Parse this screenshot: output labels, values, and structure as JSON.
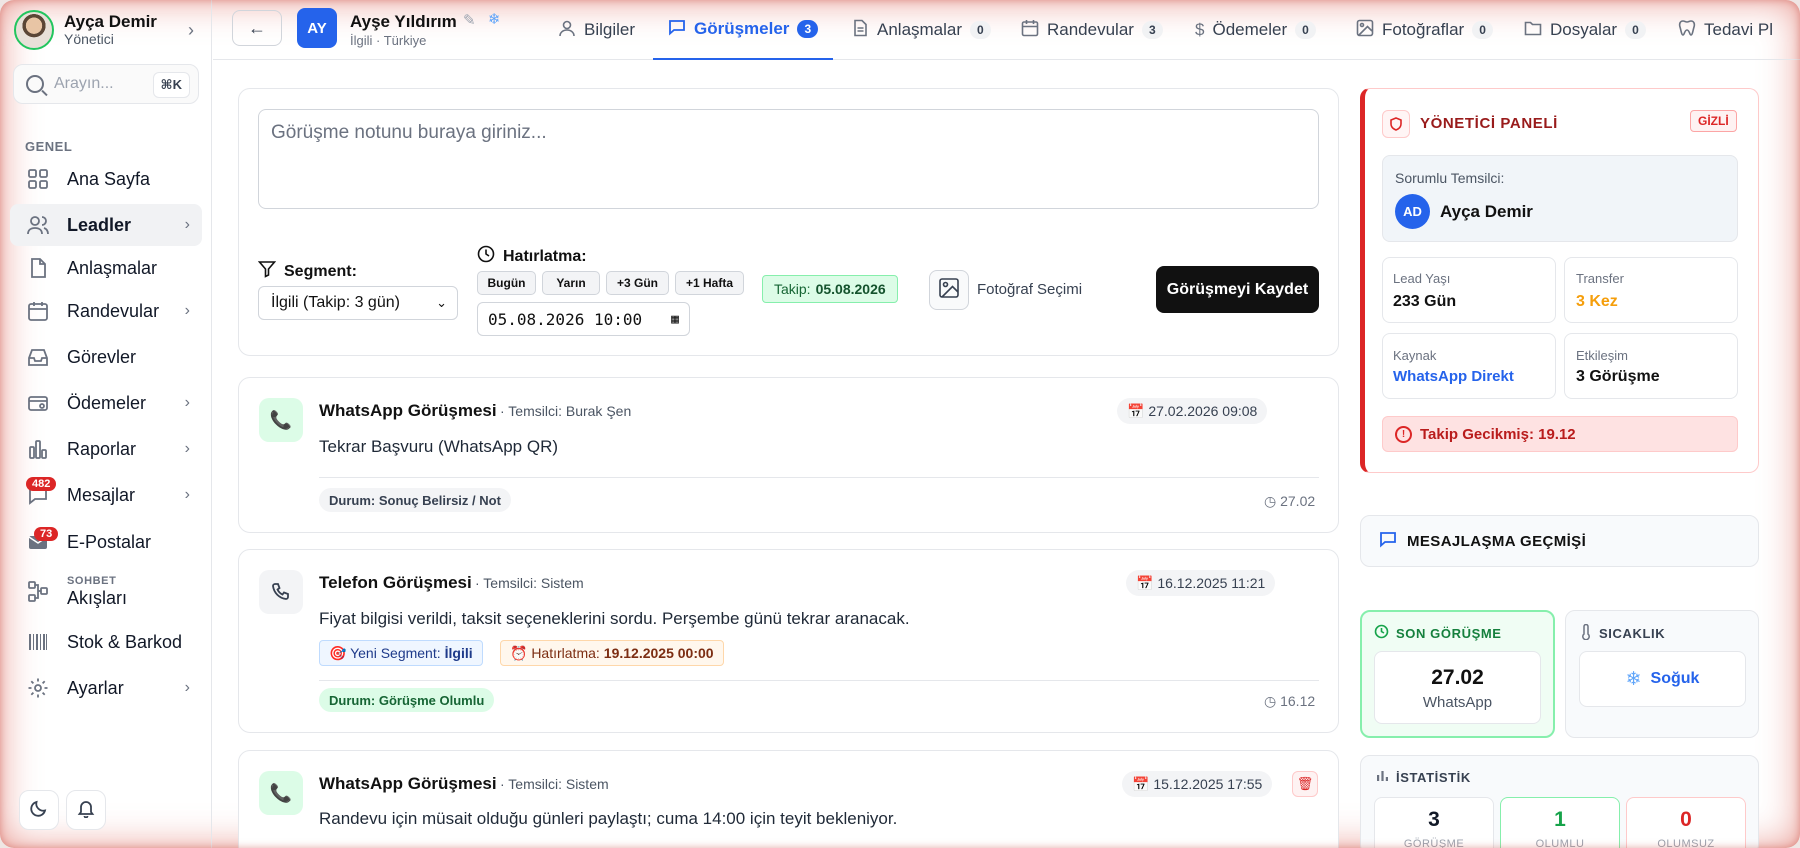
{
  "sidebar": {
    "user": {
      "name": "Ayça Demir",
      "role": "Yönetici"
    },
    "search": {
      "placeholder": "Arayın...",
      "shortcut": "⌘K"
    },
    "section_label": "GENEL",
    "items": [
      {
        "label": "Ana Sayfa",
        "icon": "grid-icon"
      },
      {
        "label": "Leadler",
        "icon": "users-icon",
        "active": true
      },
      {
        "label": "Anlaşmalar",
        "icon": "document-icon"
      },
      {
        "label": "Randevular",
        "icon": "calendar-icon"
      },
      {
        "label": "Görevler",
        "icon": "inbox-icon"
      },
      {
        "label": "Ödemeler",
        "icon": "wallet-icon"
      },
      {
        "label": "Raporlar",
        "icon": "bar-chart-icon"
      },
      {
        "label": "Mesajlar",
        "icon": "chat-icon",
        "badge": "482"
      },
      {
        "label": "E-Postalar",
        "icon": "mail-icon",
        "badge": "73"
      },
      {
        "small": "SOHBET",
        "label": "Akışları",
        "icon": "flow-icon"
      },
      {
        "label": "Stok & Barkod",
        "icon": "barcode-icon"
      },
      {
        "label": "Ayarlar",
        "icon": "gear-icon"
      }
    ]
  },
  "header": {
    "lead": {
      "initials": "AY",
      "name": "Ayşe Yıldırım",
      "sub": "İlgili · Türkiye"
    },
    "tabs": [
      {
        "label": "Bilgiler",
        "icon": "user-icon"
      },
      {
        "label": "Görüşmeler",
        "count": "3",
        "icon": "chat-icon",
        "active": true
      },
      {
        "label": "Anlaşmalar",
        "count": "0",
        "icon": "document-icon"
      },
      {
        "label": "Randevular",
        "count": "3",
        "icon": "calendar-icon"
      },
      {
        "label": "Ödemeler",
        "count": "0",
        "icon": "dollar-icon"
      },
      {
        "label": "Fotoğraflar",
        "count": "0",
        "icon": "image-icon"
      },
      {
        "label": "Dosyalar",
        "count": "0",
        "icon": "folder-icon"
      },
      {
        "label": "Tedavi Pl",
        "icon": "tooth-icon"
      }
    ]
  },
  "form": {
    "note_placeholder": "Görüşme notunu buraya giriniz...",
    "segment_label": "Segment:",
    "segment_value": "İlgili (Takip: 3 gün)",
    "reminder_label": "Hatırlatma:",
    "quick": [
      "Bugün",
      "Yarın",
      "+3 Gün",
      "+1 Hafta"
    ],
    "datetime": "05.08.2026 10:00",
    "takip_label": "Takip:",
    "takip_date": "05.08.2026",
    "photo_label": "Fotoğraf Seçimi",
    "save_label": "Görüşmeyi Kaydet"
  },
  "meetings": [
    {
      "title": "WhatsApp Görüşmesi",
      "rep": "· Temsilci: Burak Şen",
      "date": "📅 27.02.2026 09:08",
      "text": "Tekrar Başvuru (WhatsApp QR)",
      "status": "Durum: Sonuç Belirsiz / Not",
      "time": "27.02"
    },
    {
      "title": "Telefon Görüşmesi",
      "rep": "· Temsilci: Sistem",
      "date": "📅 16.12.2025 11:21",
      "text": "Fiyat bilgisi verildi, taksit seçeneklerini sordu. Perşembe günü tekrar aranacak.",
      "segment_label": "🎯 Yeni Segment:",
      "segment_value": "İlgili",
      "reminder_label": "⏰ Hatırlatma:",
      "reminder_value": "19.12.2025 00:00",
      "status": "Durum: Görüşme Olumlu",
      "time": "16.12"
    },
    {
      "title": "WhatsApp Görüşmesi",
      "rep": "· Temsilci: Sistem",
      "date": "📅 15.12.2025 17:55",
      "text": "Randevu için müsait olduğu günleri paylaştı; cuma 14:00 için teyit bekleniyor."
    }
  ],
  "admin": {
    "title": "YÖNETİCİ PANELİ",
    "badge": "GİZLİ",
    "rep_label": "Sorumlu Temsilci:",
    "rep_initials": "AD",
    "rep_name": "Ayça Demir",
    "stats": [
      {
        "label": "Lead Yaşı",
        "value": "233 Gün"
      },
      {
        "label": "Transfer",
        "value": "3 Kez"
      },
      {
        "label": "Kaynak",
        "value": "WhatsApp Direkt"
      },
      {
        "label": "Etkileşim",
        "value": "3 Görüşme"
      }
    ],
    "late": "Takip Gecikmiş: 19.12"
  },
  "messaging_history": "MESAJLAŞMA GEÇMİŞİ",
  "last_meeting": {
    "title": "SON GÖRÜŞME",
    "date": "27.02",
    "channel": "WhatsApp"
  },
  "heat": {
    "title": "SICAKLIK",
    "value": "Soğuk"
  },
  "statistics": {
    "title": "İSTATİSTİK",
    "items": [
      {
        "value": "3",
        "label": "GÖRÜŞME",
        "color": "#111827"
      },
      {
        "value": "1",
        "label": "OLUMLU",
        "color": "#16a34a"
      },
      {
        "value": "0",
        "label": "OLUMSUZ",
        "color": "#dc2626"
      }
    ]
  },
  "colors": {
    "accent": "#2563eb",
    "danger": "#dc2626",
    "success": "#16a34a"
  }
}
